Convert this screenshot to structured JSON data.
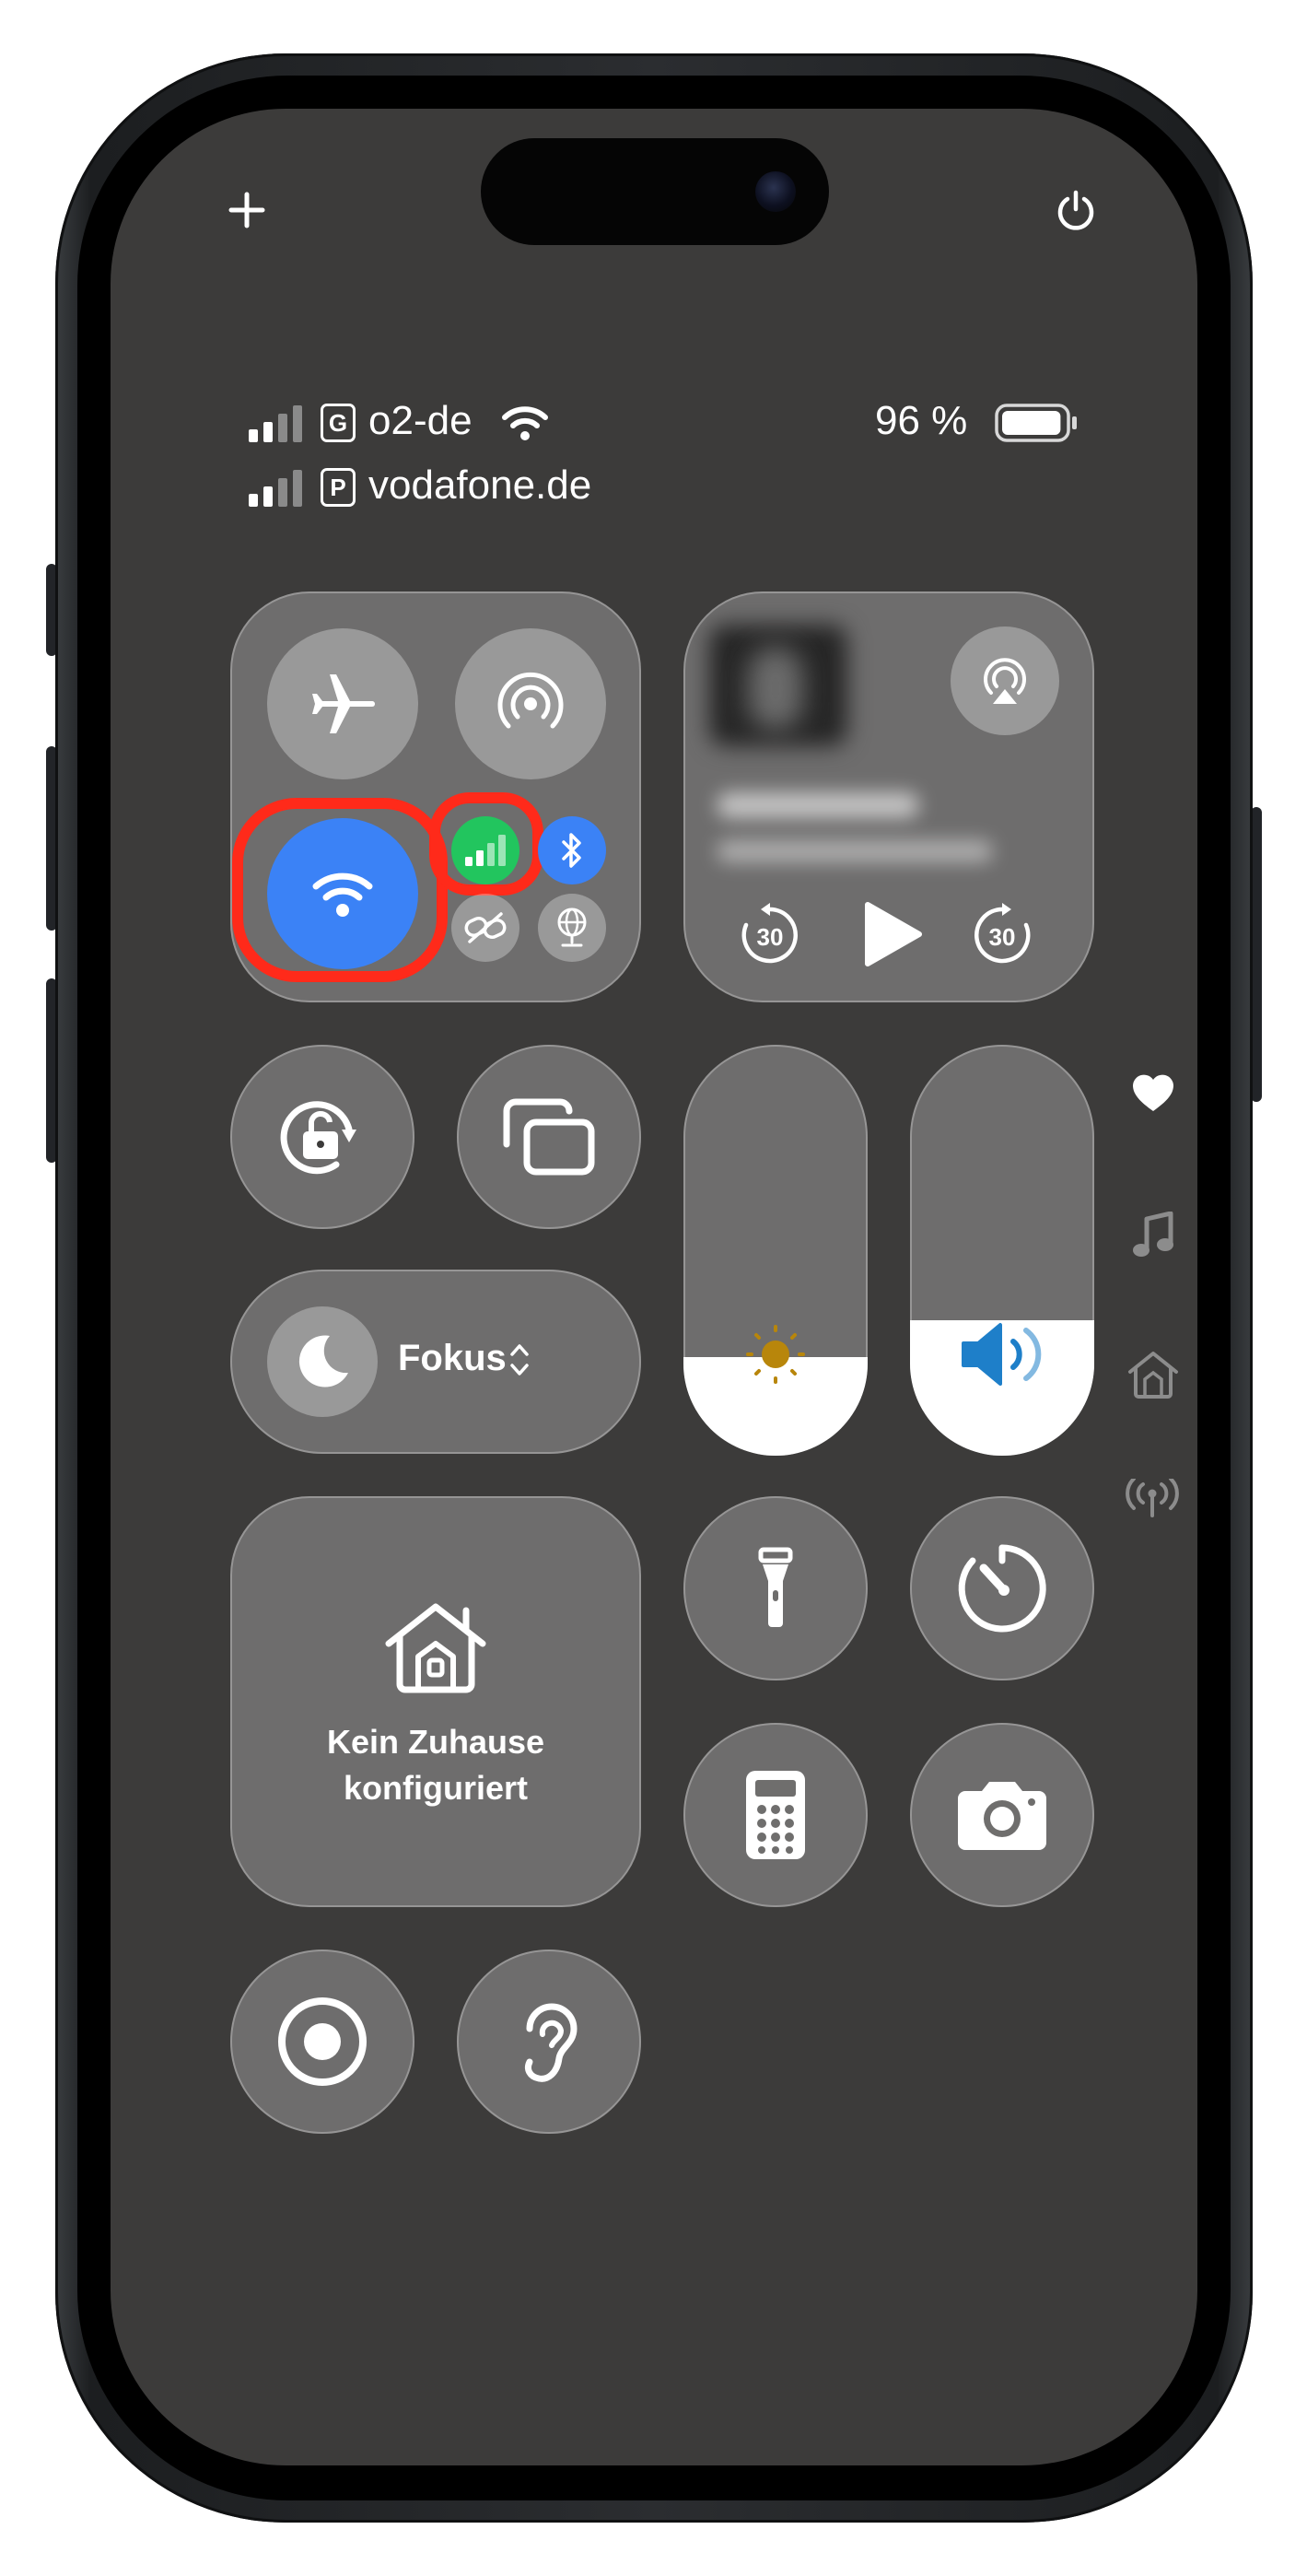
{
  "status_bar": {
    "carrier1_badge": "G",
    "carrier1_name": "o2-de",
    "carrier2_badge": "P",
    "carrier2_name": "vodafone.de",
    "battery_text": "96 %",
    "battery_level": 0.96
  },
  "top_controls": {
    "add_icon": "plus-icon",
    "power_icon": "power-icon"
  },
  "connectivity": {
    "airplane_icon": "airplane-icon",
    "airdrop_icon": "airdrop-icon",
    "wifi_icon": "wifi-icon",
    "cellular_icon": "cellular-data-icon",
    "bluetooth_icon": "bluetooth-icon",
    "hotspot_icon": "personal-hotspot-icon",
    "vpn_icon": "vpn-globe-icon",
    "wifi_color": "#3b82f6",
    "cellular_color": "#22c55e",
    "bluetooth_color": "#3b82f6",
    "highlight_color": "#ff2a1a"
  },
  "media": {
    "airplay_icon": "airplay-icon",
    "skip_back_seconds": "30",
    "skip_forward_seconds": "30"
  },
  "focus": {
    "label": "Fokus"
  },
  "sliders": {
    "brightness_level": 0.24,
    "volume_level": 0.33,
    "brightness_color": "#b8860b",
    "volume_color": "#1e7fc9"
  },
  "home": {
    "line1": "Kein Zuhause",
    "line2": "konfiguriert"
  },
  "side_pages": [
    "favorites-heart-icon",
    "music-note-icon",
    "home-icon",
    "connectivity-antenna-icon"
  ]
}
